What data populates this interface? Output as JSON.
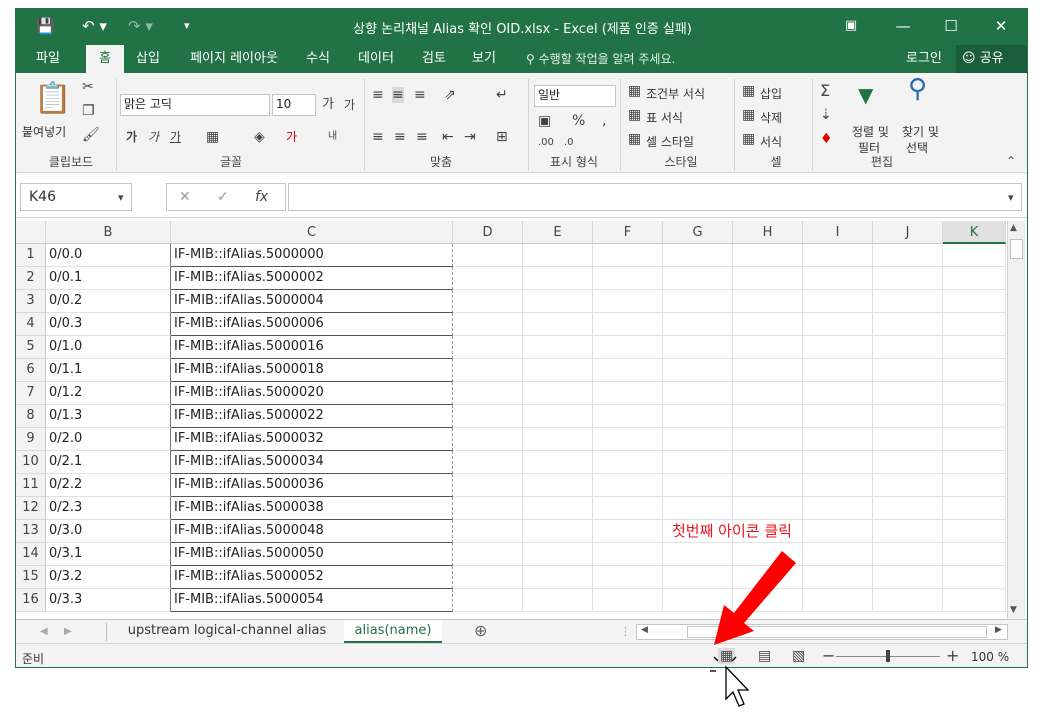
{
  "window": {
    "title": "상향 논리채널 Alias 확인 OID.xlsx - Excel (제품 인증 실패)"
  },
  "tabs": [
    {
      "label": "파일",
      "active": false
    },
    {
      "label": "홈",
      "active": true
    },
    {
      "label": "삽입",
      "active": false
    },
    {
      "label": "페이지 레이아웃",
      "active": false
    },
    {
      "label": "수식",
      "active": false
    },
    {
      "label": "데이터",
      "active": false
    },
    {
      "label": "검토",
      "active": false
    },
    {
      "label": "보기",
      "active": false
    }
  ],
  "tell_me": "수행할 작업을 알려 주세요.",
  "signin": "로그인",
  "share": "공유",
  "ribbon": {
    "clipboard": {
      "paste": "붙여넣기",
      "group": "클립보드"
    },
    "font": {
      "name": "맑은 고딕",
      "size": "10",
      "group": "글꼴"
    },
    "alignment": {
      "group": "맞춤"
    },
    "number": {
      "format": "일반",
      "group": "표시 형식"
    },
    "styles": {
      "conditional": "조건부 서식",
      "table": "표 서식",
      "cell": "셀 스타일",
      "group": "스타일"
    },
    "cells": {
      "insert": "삽입",
      "delete": "삭제",
      "format": "서식",
      "group": "셀"
    },
    "editing": {
      "sort": "정렬 및",
      "sort2": "필터",
      "find": "찾기 및",
      "find2": "선택",
      "group": "편집"
    }
  },
  "namebox": "K46",
  "columns": [
    "B",
    "C",
    "D",
    "E",
    "F",
    "G",
    "H",
    "I",
    "J",
    "K"
  ],
  "selected_column": "K",
  "rows": [
    {
      "n": "1",
      "b": "0/0.0",
      "c": "IF-MIB::ifAlias.5000000"
    },
    {
      "n": "2",
      "b": "0/0.1",
      "c": "IF-MIB::ifAlias.5000002"
    },
    {
      "n": "3",
      "b": "0/0.2",
      "c": "IF-MIB::ifAlias.5000004"
    },
    {
      "n": "4",
      "b": "0/0.3",
      "c": "IF-MIB::ifAlias.5000006"
    },
    {
      "n": "5",
      "b": "0/1.0",
      "c": "IF-MIB::ifAlias.5000016"
    },
    {
      "n": "6",
      "b": "0/1.1",
      "c": "IF-MIB::ifAlias.5000018"
    },
    {
      "n": "7",
      "b": "0/1.2",
      "c": "IF-MIB::ifAlias.5000020"
    },
    {
      "n": "8",
      "b": "0/1.3",
      "c": "IF-MIB::ifAlias.5000022"
    },
    {
      "n": "9",
      "b": "0/2.0",
      "c": "IF-MIB::ifAlias.5000032"
    },
    {
      "n": "10",
      "b": "0/2.1",
      "c": "IF-MIB::ifAlias.5000034"
    },
    {
      "n": "11",
      "b": "0/2.2",
      "c": "IF-MIB::ifAlias.5000036"
    },
    {
      "n": "12",
      "b": "0/2.3",
      "c": "IF-MIB::ifAlias.5000038"
    },
    {
      "n": "13",
      "b": "0/3.0",
      "c": "IF-MIB::ifAlias.5000048"
    },
    {
      "n": "14",
      "b": "0/3.1",
      "c": "IF-MIB::ifAlias.5000050"
    },
    {
      "n": "15",
      "b": "0/3.2",
      "c": "IF-MIB::ifAlias.5000052"
    },
    {
      "n": "16",
      "b": "0/3.3",
      "c": "IF-MIB::ifAlias.5000054"
    }
  ],
  "sheets": [
    {
      "label": "upstream logical-channel alias",
      "active": false
    },
    {
      "label": "alias(name)",
      "active": true
    }
  ],
  "status": {
    "ready": "준비",
    "zoom": "100 %"
  },
  "annotation": "첫번째 아이콘 클릭",
  "colors": {
    "accent": "#217346",
    "annotation": "#e8141c"
  }
}
